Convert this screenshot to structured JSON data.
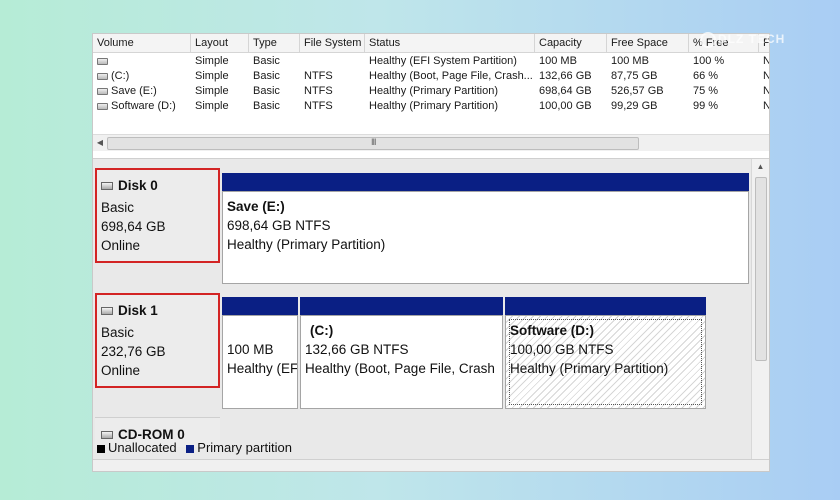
{
  "watermark": "DLZ TECH",
  "volume_list": {
    "columns": [
      "Volume",
      "Layout",
      "Type",
      "File System",
      "Status",
      "Capacity",
      "Free Space",
      "% Free",
      "F"
    ],
    "rows": [
      {
        "volume": "",
        "layout": "Simple",
        "type": "Basic",
        "fs": "",
        "status": "Healthy (EFI System Partition)",
        "capacity": "100 MB",
        "free": "100 MB",
        "pct": "100 %",
        "f": "N"
      },
      {
        "volume": "(C:)",
        "layout": "Simple",
        "type": "Basic",
        "fs": "NTFS",
        "status": "Healthy (Boot, Page File, Crash...",
        "capacity": "132,66 GB",
        "free": "87,75 GB",
        "pct": "66 %",
        "f": "N"
      },
      {
        "volume": "Save (E:)",
        "layout": "Simple",
        "type": "Basic",
        "fs": "NTFS",
        "status": "Healthy (Primary Partition)",
        "capacity": "698,64 GB",
        "free": "526,57 GB",
        "pct": "75 %",
        "f": "N"
      },
      {
        "volume": "Software (D:)",
        "layout": "Simple",
        "type": "Basic",
        "fs": "NTFS",
        "status": "Healthy (Primary Partition)",
        "capacity": "100,00 GB",
        "free": "99,29 GB",
        "pct": "99 %",
        "f": "N"
      }
    ],
    "scroll_grip": "III"
  },
  "disks": [
    {
      "title": "Disk 0",
      "type": "Basic",
      "size": "698,64 GB",
      "state": "Online",
      "partitions": [
        {
          "name": "Save  (E:)",
          "size": "698,64 GB NTFS",
          "status": "Healthy (Primary Partition)"
        }
      ]
    },
    {
      "title": "Disk 1",
      "type": "Basic",
      "size": "232,76 GB",
      "state": "Online",
      "partitions": [
        {
          "name": "",
          "size": "100 MB",
          "status": "Healthy (EFI"
        },
        {
          "name": "(C:)",
          "size": "132,66 GB NTFS",
          "status": "Healthy (Boot, Page File, Crash"
        },
        {
          "name": "Software  (D:)",
          "size": "100,00 GB NTFS",
          "status": "Healthy (Primary Partition)"
        }
      ]
    },
    {
      "title": "CD-ROM 0"
    }
  ],
  "legend": [
    {
      "label": "Unallocated",
      "color": "#000000"
    },
    {
      "label": "Primary partition",
      "color": "#0a1f84"
    }
  ],
  "colors": {
    "partition_bar": "#0a1f84",
    "highlight": "#d32424"
  }
}
